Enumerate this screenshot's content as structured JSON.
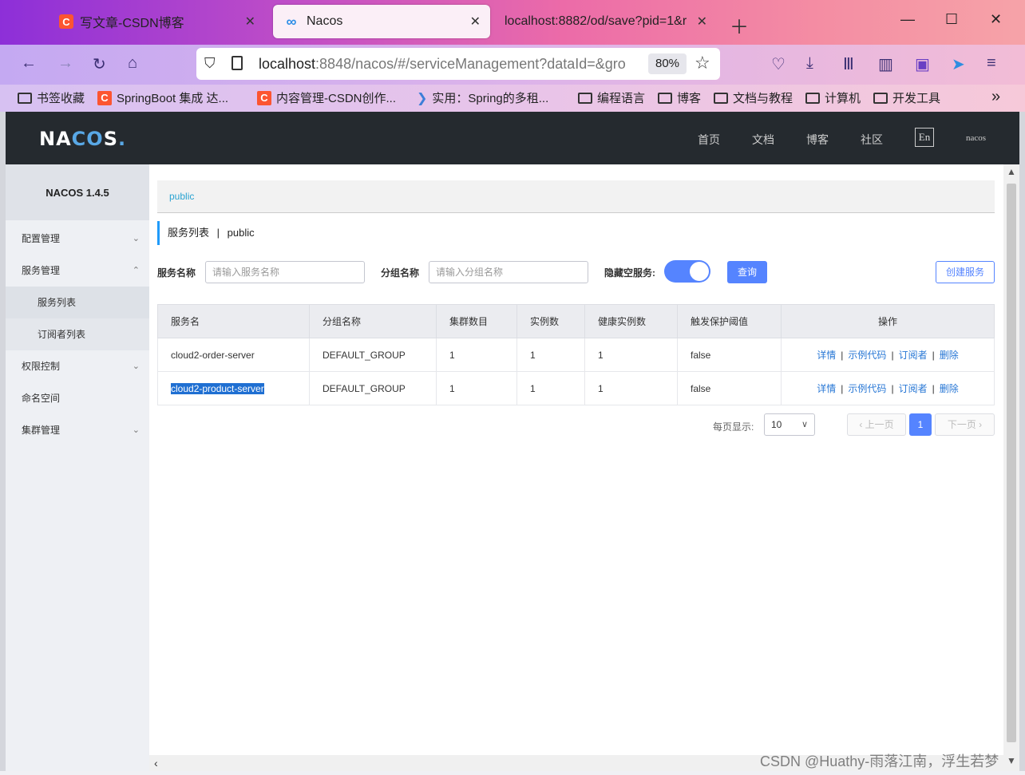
{
  "browser": {
    "tabs": [
      {
        "title": "写文章-CSDN博客",
        "favicon": "csdn-icon",
        "active": false
      },
      {
        "title": "Nacos",
        "favicon": "nacos-icon",
        "active": true
      },
      {
        "title": "localhost:8882/od/save?pid=1&r",
        "favicon": "",
        "active": false
      }
    ],
    "url_host": "localhost",
    "url_rest": ":8848/nacos/#/serviceManagement?dataId=&gro",
    "zoom": "80%",
    "bookmarks": [
      {
        "label": "书签收藏",
        "icon": "folder-icon"
      },
      {
        "label": "SpringBoot 集成 达...",
        "icon": "csdn-icon"
      },
      {
        "label": "内容管理-CSDN创作...",
        "icon": "csdn-icon"
      },
      {
        "label": "实用：Spring的多租...",
        "icon": "layers-icon"
      },
      {
        "label": "编程语言",
        "icon": "folder-icon"
      },
      {
        "label": "博客",
        "icon": "folder-icon"
      },
      {
        "label": "文档与教程",
        "icon": "folder-icon"
      },
      {
        "label": "计算机",
        "icon": "folder-icon"
      },
      {
        "label": "开发工具",
        "icon": "folder-icon"
      }
    ]
  },
  "nacos": {
    "nav": {
      "links": [
        "首页",
        "文档",
        "博客",
        "社区"
      ],
      "lang": "En",
      "user": "nacos"
    },
    "sidebar": {
      "version": "NACOS 1.4.5",
      "items": [
        {
          "label": "配置管理",
          "chevron": "⌄"
        },
        {
          "label": "服务管理",
          "chevron": "⌃"
        },
        {
          "label": "服务列表",
          "chevron": ""
        },
        {
          "label": "订阅者列表",
          "chevron": ""
        },
        {
          "label": "权限控制",
          "chevron": "⌄"
        },
        {
          "label": "命名空间",
          "chevron": ""
        },
        {
          "label": "集群管理",
          "chevron": "⌄"
        }
      ]
    },
    "namespace": "public",
    "page_title": "服务列表",
    "page_title_sep": "|",
    "page_title_ns": "public",
    "filters": {
      "service_name_label": "服务名称",
      "service_name_placeholder": "请输入服务名称",
      "group_name_label": "分组名称",
      "group_name_placeholder": "请输入分组名称",
      "hide_empty_label": "隐藏空服务:",
      "hide_empty_on": true,
      "query_label": "查询",
      "create_label": "创建服务"
    },
    "table": {
      "columns": [
        "服务名",
        "分组名称",
        "集群数目",
        "实例数",
        "健康实例数",
        "触发保护阈值",
        "操作"
      ],
      "rows": [
        [
          "cloud2-order-server",
          "DEFAULT_GROUP",
          "1",
          "1",
          "1",
          "false"
        ],
        [
          "cloud2-product-server",
          "DEFAULT_GROUP",
          "1",
          "1",
          "1",
          "false"
        ]
      ],
      "actions": [
        "详情",
        "示例代码",
        "订阅者",
        "删除"
      ]
    },
    "pagination": {
      "page_size_label": "每页显示:",
      "page_size": "10",
      "prev": "上一页",
      "current": "1",
      "next": "下一页"
    }
  },
  "watermark": "CSDN @Huathy-雨落江南，浮生若梦"
}
